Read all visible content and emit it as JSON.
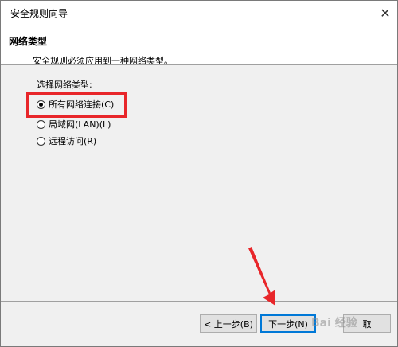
{
  "window": {
    "title": "安全规则向导",
    "close_glyph": "✕"
  },
  "header": {
    "title": "网络类型",
    "subtitle": "安全规则必须应用到一种网络类型。"
  },
  "content": {
    "group_label": "选择网络类型:",
    "options": [
      {
        "label": "所有网络连接(C)",
        "selected": true
      },
      {
        "label": "局域网(LAN)(L)",
        "selected": false
      },
      {
        "label": "远程访问(R)",
        "selected": false
      }
    ]
  },
  "footer": {
    "back_label": "< 上一步(B)",
    "next_label": "下一步(N)",
    "third_label": "取"
  },
  "annotation": {
    "highlight_color": "#e8262a",
    "arrow_color": "#e8262a"
  },
  "watermark": {
    "text": "Bai 经验"
  }
}
